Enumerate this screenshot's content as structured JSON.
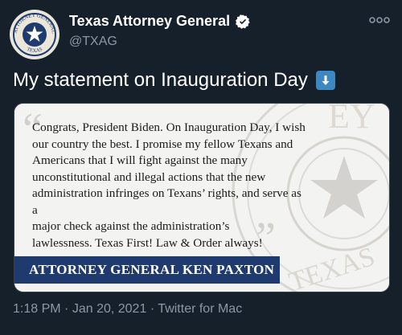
{
  "account": {
    "display_name": "Texas Attorney General",
    "handle": "@TXAG",
    "avatar_seal_top": "ATTORNEY GENERAL",
    "avatar_seal_bottom": "TEXAS"
  },
  "tweet": {
    "text": "My statement on Inauguration Day",
    "emoji": "down-arrow-icon"
  },
  "media": {
    "quote": "Congrats, President Biden. On Inauguration Day, I wish\nour country the best. I promise my fellow Texans and\nAmericans that I will fight against the many\nunconstitutional and illegal actions that the new\nadministration infringes on Texans’ rights, and serve as a\nmajor check against the administration’s\nlawlessness. Texas First! Law & Order always!",
    "banner": "ATTORNEY GENERAL KEN PAXTON",
    "seal_top": "EY",
    "seal_bottom": "TEXAS"
  },
  "meta": {
    "time": "1:18 PM",
    "date": "Jan 20, 2021",
    "source": "Twitter for Mac",
    "separator": "·"
  },
  "colors": {
    "background": "#15202b",
    "verified": "#1d9bf0",
    "banner": "#1f3a6e",
    "muted": "#8b98a5"
  }
}
